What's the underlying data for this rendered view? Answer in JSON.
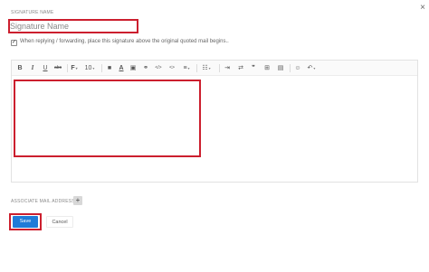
{
  "dialog": {
    "close_glyph": "×"
  },
  "signature_name": {
    "label": "SIGNATURE NAME",
    "placeholder": "Signature Name",
    "value": ""
  },
  "placement_option": {
    "checked": true,
    "check_glyph": "✓",
    "label": "When replying / forwarding, place this signature above the original quoted mail begins.."
  },
  "toolbar": {
    "bold": "B",
    "italic": "I",
    "underline": "U",
    "strikethrough": "abc",
    "font_family": "F",
    "font_size": "10",
    "text_color": "■",
    "background_color": "A",
    "image": "▣",
    "link": "⚭",
    "code": "</>",
    "html_source": "<>",
    "align": "≡",
    "list": "☷",
    "indent": "⇥",
    "quote": "❞",
    "strike_layout": "⇄",
    "table": "⊞",
    "media": "▤",
    "emoji": "☺",
    "undo": "↶",
    "caret": "▾"
  },
  "associate": {
    "label": "ASSOCIATE MAIL ADDRESS",
    "add": "+"
  },
  "actions": {
    "save": "Save",
    "cancel": "Cancel"
  },
  "colors": {
    "accent": "#1f7bd8",
    "highlight": "#cc1f2e"
  }
}
